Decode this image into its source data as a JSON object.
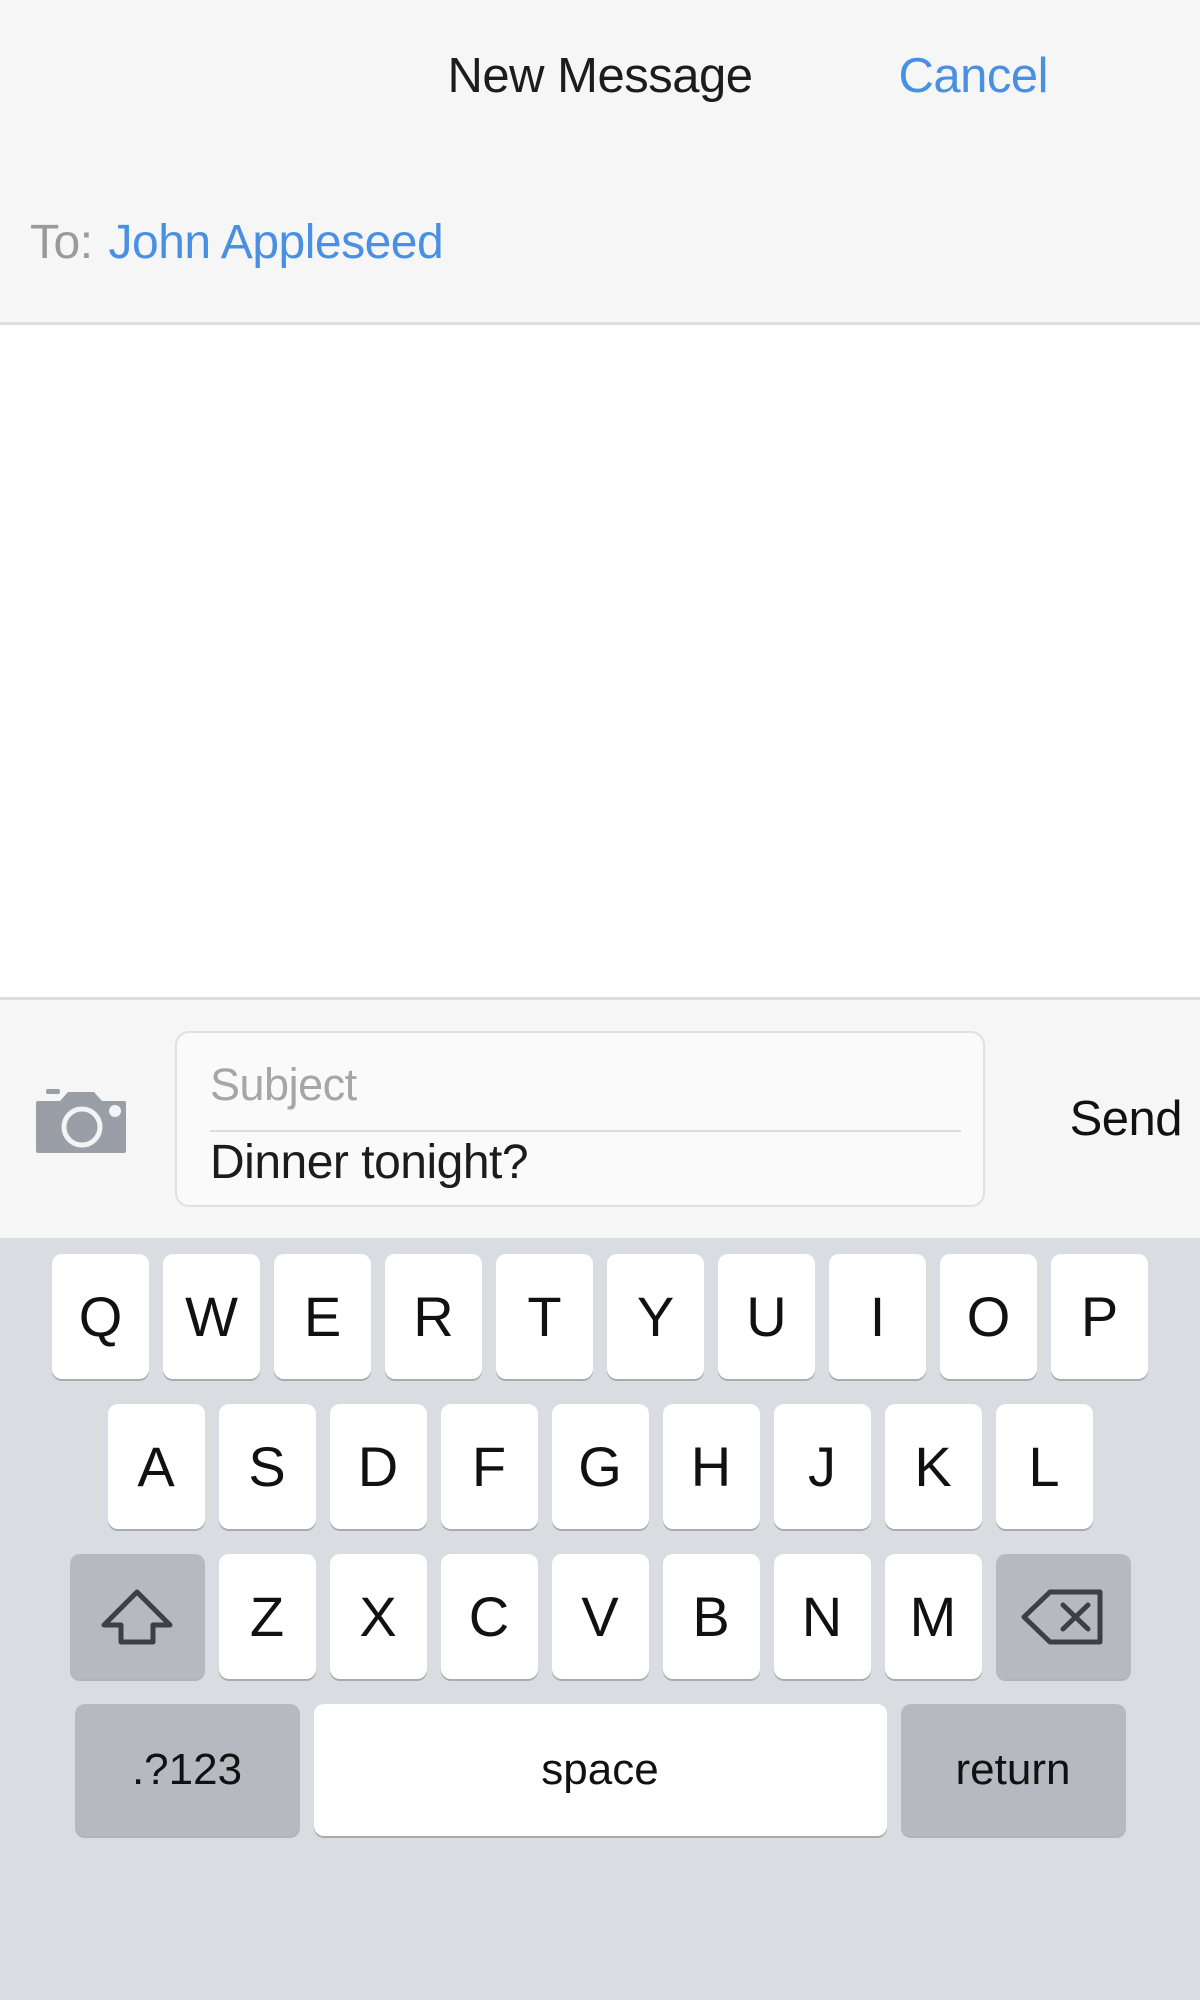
{
  "navbar": {
    "title": "New Message",
    "cancel_label": "Cancel"
  },
  "recipient": {
    "label": "To:",
    "value": "John Appleseed"
  },
  "compose": {
    "camera_icon": "camera-icon",
    "subject_placeholder": "Subject",
    "subject_value": "",
    "body_value": "Dinner tonight?",
    "send_label": "Send"
  },
  "colors": {
    "accent_blue": "#4a90e2",
    "bar_background": "#f6f6f6",
    "keyboard_background": "#d9dce0",
    "key_white": "#ffffff",
    "key_gray": "#b6bac0",
    "placeholder_gray": "#a6a6a6"
  },
  "keyboard": {
    "row1": [
      {
        "label": "Q",
        "name": "key-q"
      },
      {
        "label": "W",
        "name": "key-w"
      },
      {
        "label": "E",
        "name": "key-e"
      },
      {
        "label": "R",
        "name": "key-r"
      },
      {
        "label": "T",
        "name": "key-t"
      },
      {
        "label": "Y",
        "name": "key-y"
      },
      {
        "label": "U",
        "name": "key-u"
      },
      {
        "label": "I",
        "name": "key-i"
      },
      {
        "label": "O",
        "name": "key-o"
      },
      {
        "label": "P",
        "name": "key-p"
      }
    ],
    "row2": [
      {
        "label": "A",
        "name": "key-a"
      },
      {
        "label": "S",
        "name": "key-s"
      },
      {
        "label": "D",
        "name": "key-d"
      },
      {
        "label": "F",
        "name": "key-f"
      },
      {
        "label": "G",
        "name": "key-g"
      },
      {
        "label": "H",
        "name": "key-h"
      },
      {
        "label": "J",
        "name": "key-j"
      },
      {
        "label": "K",
        "name": "key-k"
      },
      {
        "label": "L",
        "name": "key-l"
      }
    ],
    "row3": [
      {
        "label": "Z",
        "name": "key-z"
      },
      {
        "label": "X",
        "name": "key-x"
      },
      {
        "label": "C",
        "name": "key-c"
      },
      {
        "label": "V",
        "name": "key-v"
      },
      {
        "label": "B",
        "name": "key-b"
      },
      {
        "label": "N",
        "name": "key-n"
      },
      {
        "label": "M",
        "name": "key-m"
      }
    ],
    "shift_icon": "shift-arrow-icon",
    "delete_icon": "backspace-delete-icon",
    "numeric_label": ".?123",
    "space_label": "space",
    "return_label": "return"
  }
}
